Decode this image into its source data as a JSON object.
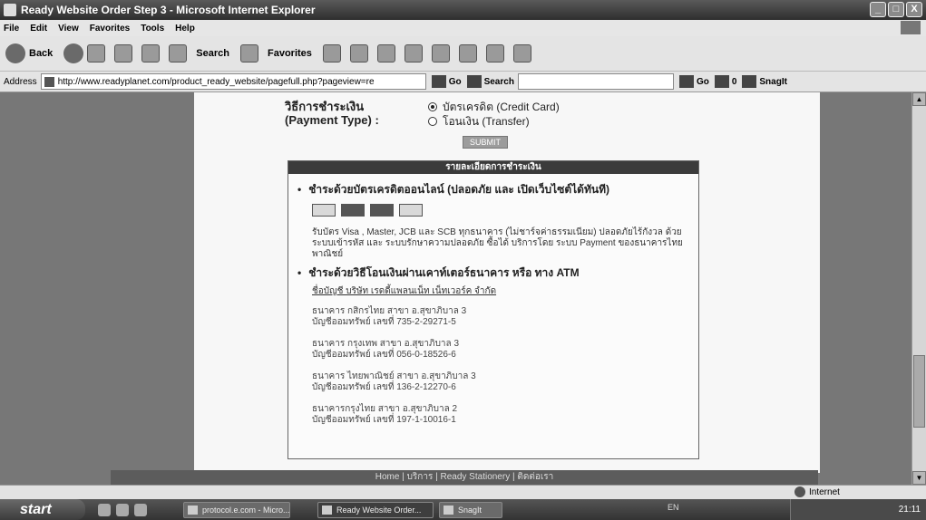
{
  "window": {
    "title": "Ready Website Order Step 3 - Microsoft Internet Explorer",
    "controls": [
      "_",
      "□",
      "X"
    ]
  },
  "menu": [
    "File",
    "Edit",
    "View",
    "Favorites",
    "Tools",
    "Help"
  ],
  "toolbar": {
    "back": "Back",
    "search": "Search",
    "favorites": "Favorites"
  },
  "address": {
    "label": "Address",
    "url": "http://www.readyplanet.com/product_ready_website/pagefull.php?pageview=re",
    "go": "Go",
    "search": "Search",
    "go2": "Go",
    "counter": "0",
    "snagit": "SnagIt"
  },
  "page": {
    "payment_label_th": "วิธีการชำระเงิน",
    "payment_label_en": "(Payment Type) :",
    "option_credit": "บัตรเครดิต (Credit Card)",
    "option_transfer": "โอนเงิน (Transfer)",
    "submit": "SUBMIT",
    "panel_title": "รายละเอียดการชำระเงิน",
    "credit_heading": "ชำระด้วยบัตรเครดิตออนไลน์ (ปลอดภัย และ เปิดเว็บไซต์ได้ทันที)",
    "credit_desc": "รับบัตร Visa , Master, JCB และ SCB ทุกธนาคาร (ไม่ชาร์จค่าธรรมเนียม) ปลอดภัยไร้กังวล ด้วยระบบเข้ารหัส และ ระบบรักษาความปลอดภัย ซื้อได้ บริการโดย ระบบ Payment ของธนาคารไทยพาณิชย์",
    "transfer_heading": "ชำระด้วยวิธีโอนเงินผ่านเคาท์เตอร์ธนาคาร หรือ ทาง ATM",
    "account_name": "ชื่อบัญชี บริษัท เรดดี้แพลนเน็ท เน็ทเวอร์ค จำกัด",
    "banks": [
      {
        "line1": "ธนาคาร กสิกรไทย สาขา อ.สุขาภิบาล 3",
        "line2": "บัญชีออมทรัพย์ เลขที่ 735-2-29271-5"
      },
      {
        "line1": "ธนาคาร กรุงเทพ สาขา อ.สุขาภิบาล 3",
        "line2": "บัญชีออมทรัพย์ เลขที่ 056-0-18526-6"
      },
      {
        "line1": "ธนาคาร ไทยพาณิชย์ สาขา อ.สุขาภิบาล 3",
        "line2": "บัญชีออมทรัพย์ เลขที่ 136-2-12270-6"
      },
      {
        "line1": "ธนาคารกรุงไทย สาขา อ.สุขาภิบาล 2",
        "line2": "บัญชีออมทรัพย์ เลขที่ 197-1-10016-1"
      }
    ],
    "footer": "Home | บริการ | Ready Stationery | ติดต่อเรา"
  },
  "status": {
    "zone": "Internet"
  },
  "taskbar": {
    "start": "start",
    "tasks": [
      "protocol.e.com - Micro...",
      "Ready Website Order...",
      "SnagIt"
    ],
    "lang": "EN",
    "clock": "21:11"
  }
}
